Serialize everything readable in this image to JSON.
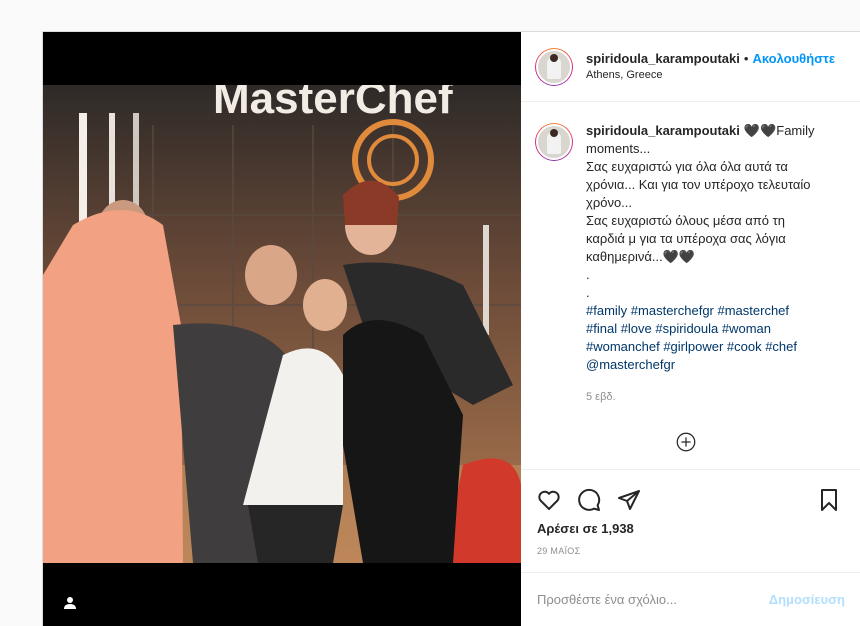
{
  "post": {
    "username": "spiridoula_karampoutaki",
    "follow_label": "Ακολουθήστε",
    "separator": "•",
    "location": "Athens, Greece",
    "photo_sign": "MasterChef",
    "caption": {
      "username": "spiridoula_karampoutaki",
      "lines": [
        "🖤🖤Family moments...",
        "Σας ευχαριστώ για όλα όλα αυτά τα χρόνια... Και για τον υπέροχο τελευταίο χρόνο...",
        "Σας ευχαριστώ όλους μέσα από τη καρδιά μ για τα υπέροχα σας λόγια καθημερινά...🖤🖤",
        ".",
        "."
      ],
      "hashtags": "#family #masterchefgr #masterchef #final #love #spiridoula #woman #womanchef #girlpower #cook #chef @masterchefgr"
    },
    "caption_time": "5 εβδ.",
    "likes": "Αρέσει σε 1,938",
    "date": "29 ΜΑΪΟΣ",
    "comment_placeholder": "Προσθέστε ένα σχόλιο...",
    "publish_label": "Δημοσίευση"
  },
  "icons": {
    "like": "heart-icon",
    "comment": "comment-icon",
    "share": "share-icon",
    "save": "bookmark-icon",
    "more": "plus-circle-icon",
    "tag": "user-tag-icon"
  },
  "colors": {
    "link": "#0095f6",
    "hashtag": "#00376b",
    "publish_disabled": "#b2dffc"
  }
}
